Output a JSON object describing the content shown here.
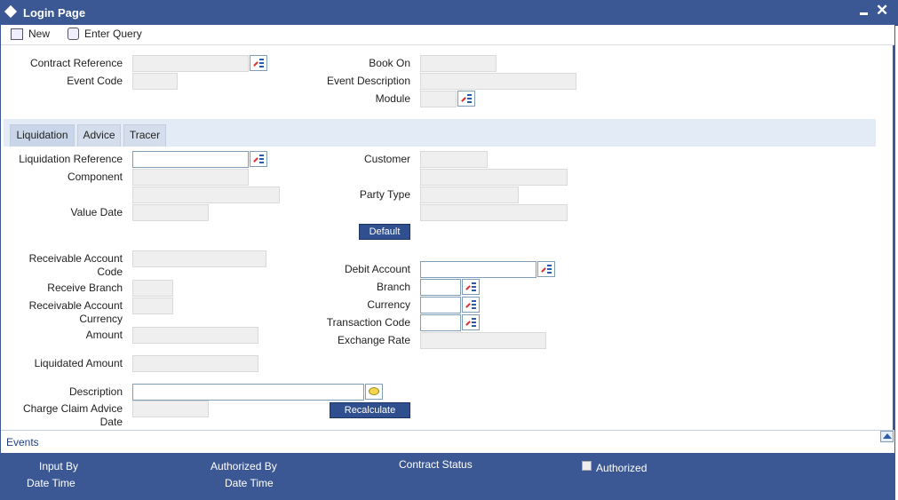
{
  "window": {
    "title": "Login Page"
  },
  "toolbar": {
    "new_label": "New",
    "enter_query_label": "Enter Query"
  },
  "header": {
    "contract_reference_label": "Contract Reference",
    "event_code_label": "Event Code",
    "book_on_label": "Book On",
    "event_description_label": "Event Description",
    "module_label": "Module"
  },
  "tabs": [
    {
      "label": "Liquidation"
    },
    {
      "label": "Advice"
    },
    {
      "label": "Tracer"
    }
  ],
  "liquidation": {
    "liquidation_reference_label": "Liquidation Reference",
    "component_label": "Component",
    "value_date_label": "Value Date",
    "customer_label": "Customer",
    "party_type_label": "Party Type",
    "default_button": "Default",
    "receivable_account_code_label_1": "Receivable Account",
    "receivable_account_code_label_2": "Code",
    "receive_branch_label": "Receive Branch",
    "receivable_account_currency_label_1": "Receivable Account",
    "receivable_account_currency_label_2": "Currency",
    "amount_label": "Amount",
    "liquidated_amount_label": "Liquidated Amount",
    "debit_account_label": "Debit Account",
    "branch_label": "Branch",
    "currency_label": "Currency",
    "transaction_code_label": "Transaction Code",
    "exchange_rate_label": "Exchange Rate",
    "description_label": "Description",
    "charge_claim_advice_date_label_1": "Charge Claim Advice",
    "charge_claim_advice_date_label_2": "Date",
    "recalculate_button": "Recalculate"
  },
  "events": {
    "label": "Events"
  },
  "footer": {
    "input_by_label": "Input By",
    "date_time_label_1": "Date Time",
    "authorized_by_label": "Authorized By",
    "date_time_label_2": "Date Time",
    "contract_status_label": "Contract Status",
    "authorized_label": "Authorized"
  },
  "colors": {
    "accent": "#3c5894",
    "tab_strip": "#e3ebf7",
    "button": "#2f4f8f"
  },
  "icons": [
    "new-icon",
    "enter-query-icon",
    "lov-icon",
    "comment-icon",
    "close-icon",
    "minimize-icon",
    "collapse-icon"
  ]
}
